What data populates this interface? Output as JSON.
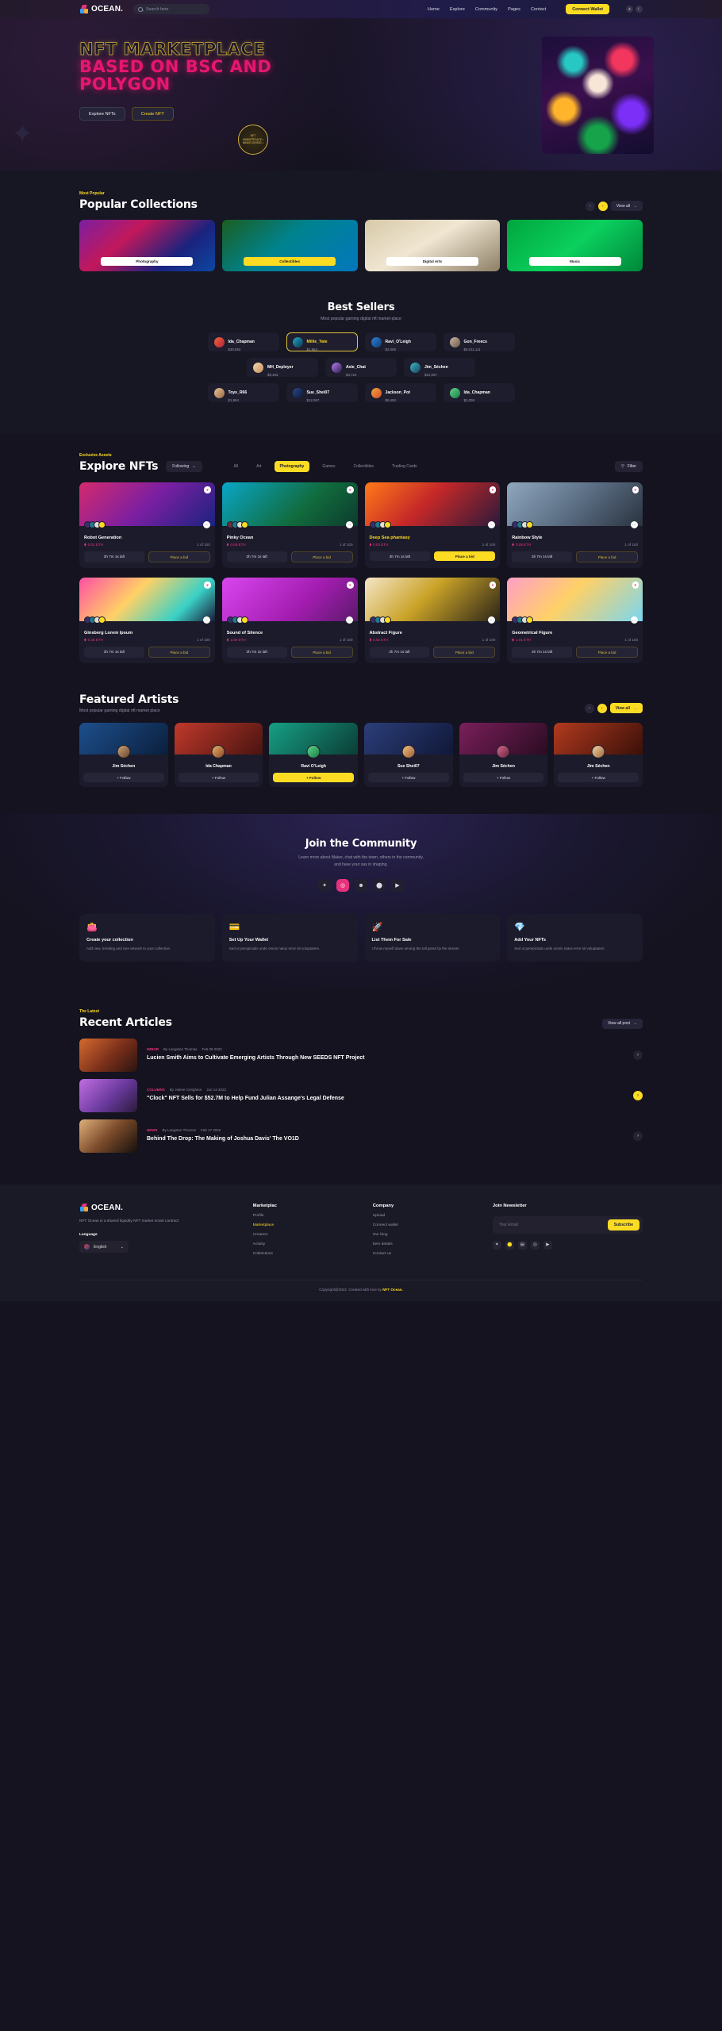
{
  "brand": {
    "name": "OCEAN."
  },
  "nav": {
    "search_placeholder": "Search here",
    "links": [
      "Home",
      "Explore",
      "Community",
      "Pages",
      "Contact"
    ],
    "wallet_label": "Connect Wallet",
    "theme_light_icon": "sun-icon",
    "theme_dark_icon": "moon-icon"
  },
  "hero": {
    "line1": "NFT MARKETPLACE",
    "line2": "BASED ON BSC AND",
    "line3": "POLYGON",
    "btn_primary": "Explore NFTs",
    "btn_secondary": "Create NFT",
    "badge": "NFT MARKETPLACE • BASED ON BSC •"
  },
  "popular": {
    "eyebrow": "Most Popular",
    "title": "Popular Collections",
    "view_all": "View all",
    "cards": [
      {
        "label": "Photography",
        "highlight": false
      },
      {
        "label": "Collectibles",
        "highlight": true
      },
      {
        "label": "Digital Arts",
        "highlight": false
      },
      {
        "label": "Music",
        "highlight": false
      }
    ]
  },
  "best_sellers": {
    "title": "Best Sellers",
    "subtitle": "Most popular gaming digital nft market place",
    "rows": [
      [
        {
          "name": "Ida_Chapman",
          "value": "$30,652",
          "highlight": false
        },
        {
          "name": "Millie_Yate",
          "value": "$1,954",
          "highlight": true
        },
        {
          "name": "Ravi_O'Leigh",
          "value": "$2,008",
          "highlight": false
        },
        {
          "name": "Gon_Freecs",
          "value": "$5,011,111",
          "highlight": false
        }
      ],
      [
        {
          "name": "MH_Deployer",
          "value": "$9,493",
          "highlight": false
        },
        {
          "name": "Axie_Chat",
          "value": "$4,724",
          "highlight": false
        },
        {
          "name": "Jim_Séchen",
          "value": "$12,067",
          "highlight": false
        }
      ],
      [
        {
          "name": "Toys_R66",
          "value": "$1,954",
          "highlight": false
        },
        {
          "name": "Sue_Shei07",
          "value": "$12,067",
          "highlight": false
        },
        {
          "name": "Jackson_Pot",
          "value": "$9,493",
          "highlight": false
        },
        {
          "name": "Ida_Chapman",
          "value": "$2,008",
          "highlight": false
        }
      ]
    ]
  },
  "explore": {
    "eyebrow": "Exclusive Assets",
    "title": "Explore NFTs",
    "following_label": "Following",
    "filter_label": "Filter",
    "tabs": [
      {
        "label": "All",
        "active": false
      },
      {
        "label": "Art",
        "active": false
      },
      {
        "label": "Photography",
        "active": true
      },
      {
        "label": "Games",
        "active": false
      },
      {
        "label": "Collectibles",
        "active": false
      },
      {
        "label": "Trading Cards",
        "active": false
      }
    ],
    "nfts": [
      {
        "title": "Robot Generation",
        "price": "0.01 ETH",
        "edition": "1 of 100",
        "time": "3h 7m 1s laft",
        "bid": "Place a bid",
        "bid_solid": false,
        "title_yellow": false
      },
      {
        "title": "Pinky Ocean",
        "price": "0.08 ETH",
        "edition": "1 of 100",
        "time": "3h 7m 1s laft",
        "bid": "Place a bid",
        "bid_solid": false,
        "title_yellow": false
      },
      {
        "title": "Deep Sea phantasy",
        "price": "0.03 ETH",
        "edition": "1 of 100",
        "time": "3h 7m 1s laft",
        "bid": "Place a bid",
        "bid_solid": true,
        "title_yellow": true
      },
      {
        "title": "Rainbow Style",
        "price": "0.08 ETH",
        "edition": "1 of 100",
        "time": "3h 7m 1s laft",
        "bid": "Place a bid",
        "bid_solid": false,
        "title_yellow": false
      },
      {
        "title": "Ginsberg Lorem Ipsum",
        "price": "0.45 ETH",
        "edition": "1 of 100",
        "time": "3h 7m 1s laft",
        "bid": "Place a bid",
        "bid_solid": false,
        "title_yellow": false
      },
      {
        "title": "Sound of Silence",
        "price": "2.08 ETH",
        "edition": "1 of 100",
        "time": "3h 7m 1s laft",
        "bid": "Place a bid",
        "bid_solid": false,
        "title_yellow": false
      },
      {
        "title": "Abstract Figure",
        "price": "0.02 ETH",
        "edition": "1 of 100",
        "time": "3h 7m 1s laft",
        "bid": "Place a bid",
        "bid_solid": false,
        "title_yellow": false
      },
      {
        "title": "Geometrical Figure",
        "price": "1.01 ETH",
        "edition": "1 of 100",
        "time": "3h 7m 1s laft",
        "bid": "Place a bid",
        "bid_solid": false,
        "title_yellow": false
      }
    ]
  },
  "artists": {
    "title": "Featured Artists",
    "subtitle": "Most popular gaming digital nft market place",
    "view_all": "View all",
    "items": [
      {
        "name": "Jim Séchen",
        "follow": "+ Follow",
        "active": false
      },
      {
        "name": "Ida Chapman",
        "follow": "+ Follow",
        "active": false
      },
      {
        "name": "Ravi O'Leigh",
        "follow": "+ Follow",
        "active": true
      },
      {
        "name": "Sue Shei07",
        "follow": "+ Follow",
        "active": false
      },
      {
        "name": "Jim Séchen",
        "follow": "+ Follow",
        "active": false
      },
      {
        "name": "Jim Séchen",
        "follow": "+ Follow",
        "active": false
      }
    ]
  },
  "community": {
    "title": "Join the Community",
    "subtitle_l1": "Learn more about Maker, chat with the team, others in the community,",
    "subtitle_l2": "and have your say in shaping.",
    "socials": [
      "twitter-icon",
      "instagram-icon",
      "discord-icon",
      "github-icon",
      "youtube-icon"
    ],
    "features": [
      {
        "icon": "👛",
        "title": "Create your collection",
        "desc": "Add new, trending and rare artwork to your collection."
      },
      {
        "icon": "💳",
        "title": "Set Up Your Wallet",
        "desc": "Sed ut perspiciatis unde omnis natus error sit voluptatem."
      },
      {
        "icon": "🚀",
        "title": "List Them For Sale",
        "desc": "I throw myself down among the tall grass by the stream"
      },
      {
        "icon": "💎",
        "title": "Add Your NFTs",
        "desc": "Sed ut perspiciatis unde omnis natus error sit voluptatem."
      }
    ]
  },
  "articles": {
    "eyebrow": "The Latest",
    "title": "Recent Articles",
    "view_all": "View all post",
    "items": [
      {
        "cat": "MINOR",
        "by": "By Langston Thomas",
        "date": "Feb 08 2022",
        "title": "Lucien Smith Aims to Cultivate Emerging Artists Through New SEEDS NFT Project",
        "arrow_yellow": false
      },
      {
        "cat": "COLUMNS",
        "by": "By Jolene Creighton",
        "date": "Jun 14 2022",
        "title": "\"Clock\" NFT Sells for $52.7M to Help Fund Julian Assange's Legal Defense",
        "arrow_yellow": true
      },
      {
        "cat": "NEWS",
        "by": "By Langston Thomas",
        "date": "Feb 17 2022",
        "title": "Behind The Drop: The Making of Joshua Davis' The VO1D",
        "arrow_yellow": false
      }
    ]
  },
  "footer": {
    "desc": "NFT Ocean is a shared liquidity NFT market smart contract",
    "language_label": "Language",
    "language_value": "English",
    "columns": [
      {
        "heading": "Marketplac",
        "items": [
          {
            "label": "Profile",
            "active": false
          },
          {
            "label": "Marketplace",
            "active": true
          },
          {
            "label": "Creators",
            "active": false
          },
          {
            "label": "Activity",
            "active": false
          },
          {
            "label": "Colletctions",
            "active": false
          }
        ]
      },
      {
        "heading": "Company",
        "items": [
          {
            "label": "Upload",
            "active": false
          },
          {
            "label": "Connect wallet",
            "active": false
          },
          {
            "label": "Our blog",
            "active": false
          },
          {
            "label": "Item details",
            "active": false
          },
          {
            "label": "Contact us",
            "active": false
          }
        ]
      }
    ],
    "newsletter_heading": "Join Newsletter",
    "email_placeholder": "Your Email",
    "subscribe_label": "Subscribe",
    "socials": [
      "twitter-icon",
      "github-icon",
      "book-icon",
      "instagram-icon",
      "youtube-icon"
    ],
    "copyright_pre": "Copyright@2022. Created with love by ",
    "copyright_brand": "NFT Ocean."
  },
  "colors": {
    "accent": "#fcdc23",
    "pink": "#e8317d",
    "bg": "#14131f",
    "card": "#1c1b2b"
  }
}
